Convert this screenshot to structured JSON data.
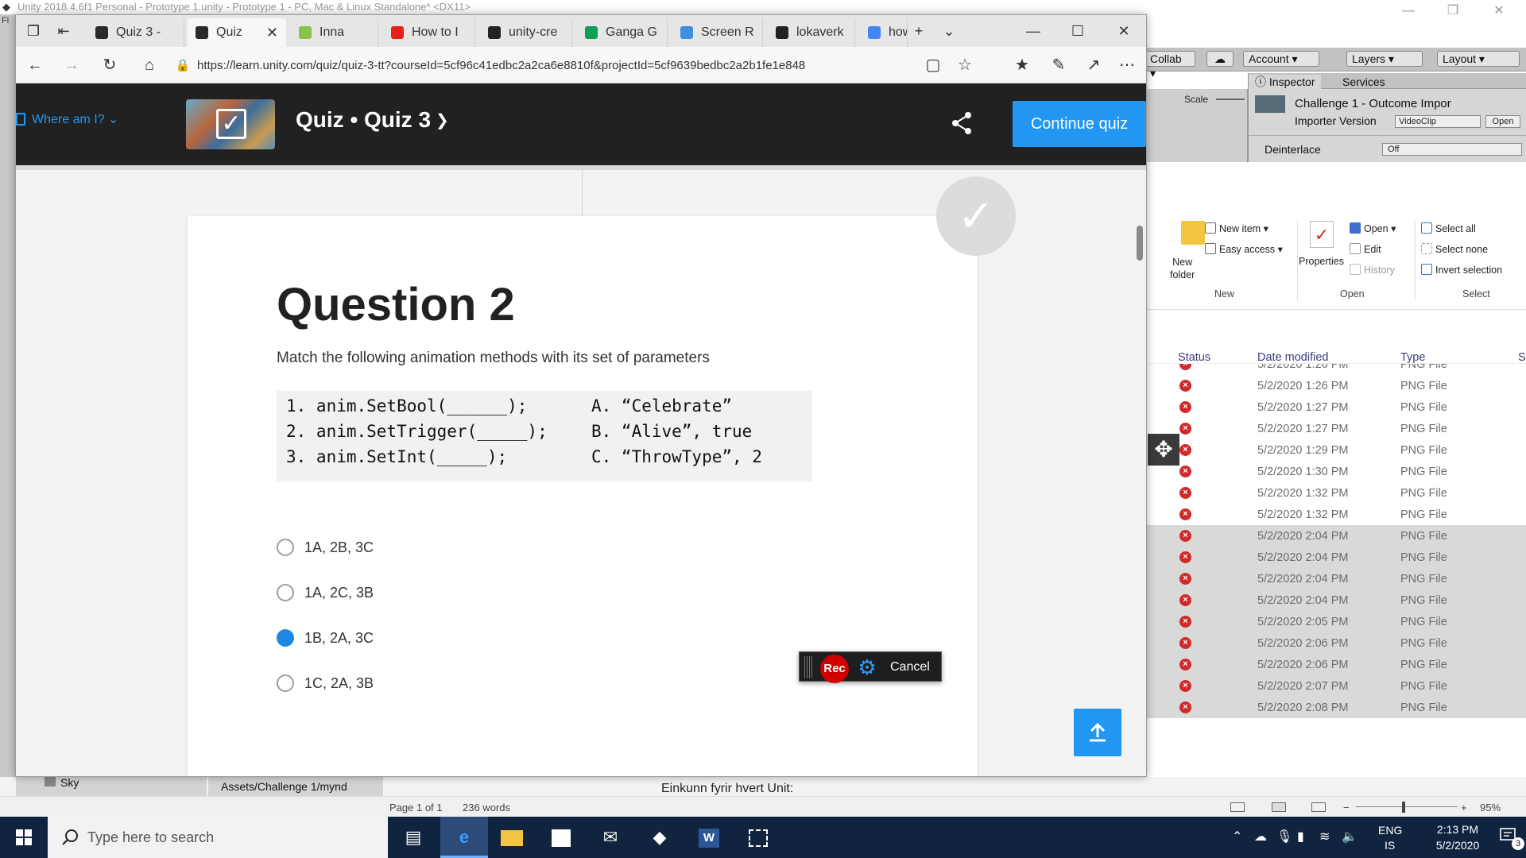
{
  "unity": {
    "title": "Unity 2018.4.6f1 Personal - Prototype 1.unity - Prototype 1 - PC, Mac & Linux Standalone* <DX11>",
    "menu_stub": "Fi",
    "toolbar": {
      "collab": "Collab",
      "account": "Account",
      "layers": "Layers",
      "layout": "Layout"
    },
    "scale_label": "Scale",
    "inspector": {
      "tab_inspector": "Inspector",
      "tab_services": "Services",
      "asset_title": "Challenge 1 - Outcome Impor",
      "importer_label": "Importer Version",
      "importer_value": "VideoClip",
      "open_label": "Open",
      "deinterlace_label": "Deinterlace",
      "deinterlace_value": "Off"
    },
    "project": {
      "tree_item": "Sky",
      "path": "Assets/Challenge 1/mynd"
    }
  },
  "explorer": {
    "ribbon": {
      "new_item": "New item",
      "easy_access": "Easy access",
      "new_folder": "New\nfolder",
      "group_new": "New",
      "properties": "Properties",
      "open": "Open",
      "edit": "Edit",
      "history": "History",
      "group_open": "Open",
      "select_all": "Select all",
      "select_none": "Select none",
      "invert_selection": "Invert selection",
      "group_select": "Select"
    },
    "columns": {
      "status": "Status",
      "date_modified": "Date modified",
      "type": "Type",
      "size": "S"
    },
    "rows": [
      {
        "date": "5/2/2020 1:26 PM",
        "type": "PNG File",
        "selected": false
      },
      {
        "date": "5/2/2020 1:26 PM",
        "type": "PNG File",
        "selected": false
      },
      {
        "date": "5/2/2020 1:27 PM",
        "type": "PNG File",
        "selected": false
      },
      {
        "date": "5/2/2020 1:27 PM",
        "type": "PNG File",
        "selected": false
      },
      {
        "date": "5/2/2020 1:29 PM",
        "type": "PNG File",
        "selected": false
      },
      {
        "date": "5/2/2020 1:30 PM",
        "type": "PNG File",
        "selected": false
      },
      {
        "date": "5/2/2020 1:32 PM",
        "type": "PNG File",
        "selected": false
      },
      {
        "date": "5/2/2020 1:32 PM",
        "type": "PNG File",
        "selected": false
      },
      {
        "date": "5/2/2020 2:04 PM",
        "type": "PNG File",
        "selected": true
      },
      {
        "date": "5/2/2020 2:04 PM",
        "type": "PNG File",
        "selected": true
      },
      {
        "date": "5/2/2020 2:04 PM",
        "type": "PNG File",
        "selected": true
      },
      {
        "date": "5/2/2020 2:04 PM",
        "type": "PNG File",
        "selected": true
      },
      {
        "date": "5/2/2020 2:05 PM",
        "type": "PNG File",
        "selected": true
      },
      {
        "date": "5/2/2020 2:06 PM",
        "type": "PNG File",
        "selected": true
      },
      {
        "date": "5/2/2020 2:06 PM",
        "type": "PNG File",
        "selected": true
      },
      {
        "date": "5/2/2020 2:07 PM",
        "type": "PNG File",
        "selected": true
      },
      {
        "date": "5/2/2020 2:08 PM",
        "type": "PNG File",
        "selected": true
      }
    ]
  },
  "word": {
    "doc_line": "Einkunn fyrir hvert Unit:",
    "page_info": "Page 1 of 1",
    "word_count": "236 words",
    "zoom": "95%"
  },
  "browser": {
    "tabs": [
      {
        "label": "Quiz 3 -",
        "icon": "unity-icon",
        "icon_color": "#2a2a2a",
        "active": false
      },
      {
        "label": "Quiz",
        "icon": "unity-icon",
        "icon_color": "#2a2a2a",
        "active": true
      },
      {
        "label": "Inna",
        "icon": "inna-icon",
        "icon_color": "#8bc34a",
        "active": false
      },
      {
        "label": "How to I",
        "icon": "youtube-icon",
        "icon_color": "#e62117",
        "active": false
      },
      {
        "label": "unity-cre",
        "icon": "github-icon",
        "icon_color": "#222222",
        "active": false
      },
      {
        "label": "Ganga G",
        "icon": "sheets-icon",
        "icon_color": "#0f9d58",
        "active": false
      },
      {
        "label": "Screen R",
        "icon": "screen-recorder-icon",
        "icon_color": "#3d8fe0",
        "active": false
      },
      {
        "label": "lokaverk",
        "icon": "github-icon",
        "icon_color": "#222222",
        "active": false
      },
      {
        "label": "how to c",
        "icon": "google-icon",
        "icon_color": "#4285f4",
        "active": false
      }
    ],
    "url": "https://learn.unity.com/quiz/quiz-3-tt?courseId=5cf96c41edbc2a2ca6e8810f&projectId=5cf9639bedbc2a2b1fe1e848"
  },
  "site": {
    "where_am_i": "Where am I?",
    "quiz_title": "Quiz • Quiz 3",
    "continue_label": "Continue quiz"
  },
  "question": {
    "title": "Question 2",
    "prompt": "Match the following animation methods with its set of parameters",
    "methods": [
      "1. anim.SetBool(______);",
      "2. anim.SetTrigger(_____);",
      "3. anim.SetInt(_____);"
    ],
    "params": [
      "A. “Celebrate”",
      "B. “Alive”, true",
      "C. “ThrowType”, 2"
    ],
    "options": [
      {
        "label": "1A, 2B, 3C",
        "selected": false
      },
      {
        "label": "1A, 2C, 3B",
        "selected": false
      },
      {
        "label": "1B, 2A, 3C",
        "selected": true
      },
      {
        "label": "1C, 2A, 3B",
        "selected": false
      }
    ]
  },
  "recorder": {
    "rec_label": "Rec",
    "cancel_label": "Cancel"
  },
  "taskbar": {
    "search_placeholder": "Type here to search",
    "lang_top": "ENG",
    "lang_bottom": "IS",
    "time": "2:13 PM",
    "date": "5/2/2020",
    "notifications": "3"
  },
  "colors": {
    "accent": "#2196f3",
    "header_bg": "#212121",
    "taskbar_bg": "#10243f",
    "rec_red": "#d10000"
  }
}
